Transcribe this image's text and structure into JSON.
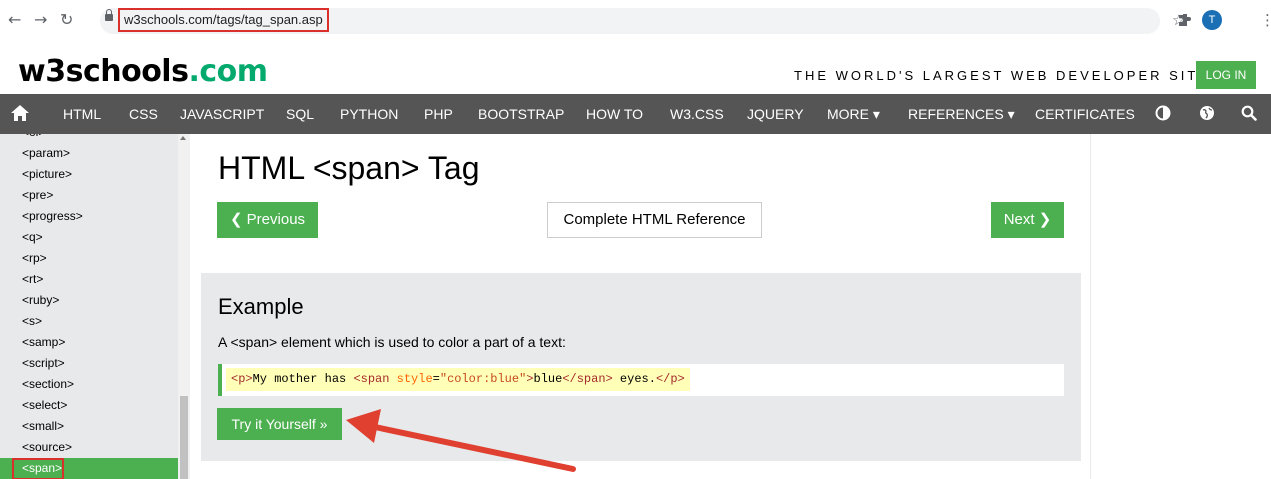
{
  "browser": {
    "back_icon": "back-arrow-icon",
    "forward_icon": "forward-arrow-icon",
    "reload_icon": "reload-icon",
    "url": "w3schools.com/tags/tag_span.asp",
    "profile_initial": "T"
  },
  "site": {
    "logo_main": "w3schools",
    "logo_tld": ".com",
    "tagline": "THE WORLD'S LARGEST WEB DEVELOPER SITE",
    "login_label": "LOG IN",
    "accent_color": "#4caf50"
  },
  "topnav": {
    "items": [
      "HTML",
      "CSS",
      "JAVASCRIPT",
      "SQL",
      "PYTHON",
      "PHP",
      "BOOTSTRAP",
      "HOW TO",
      "W3.CSS",
      "JQUERY",
      "MORE ▾",
      "REFERENCES ▾",
      "CERTIFICATES"
    ]
  },
  "sidebar": {
    "items": [
      "<ol>",
      "<param>",
      "<picture>",
      "<pre>",
      "<progress>",
      "<q>",
      "<rp>",
      "<rt>",
      "<ruby>",
      "<s>",
      "<samp>",
      "<script>",
      "<section>",
      "<select>",
      "<small>",
      "<source>",
      "<span>"
    ],
    "active": "<span>"
  },
  "main": {
    "title": "HTML <span> Tag",
    "prev_label": "❮ Previous",
    "reference_label": "Complete HTML Reference",
    "next_label": "Next ❯",
    "example_heading": "Example",
    "example_desc": "A <span> element which is used to color a part of a text:",
    "code": {
      "p_open": "<p>",
      "text1": "My mother has ",
      "span_open_tag": "<span",
      "attr_name": " style",
      "eq": "=",
      "attr_value": "\"color:blue\"",
      "span_close_bracket": ">",
      "text2": "blue",
      "span_close": "</span>",
      "text3": " eyes.",
      "p_close": "</p>"
    },
    "tryit_label": "Try it Yourself »"
  }
}
